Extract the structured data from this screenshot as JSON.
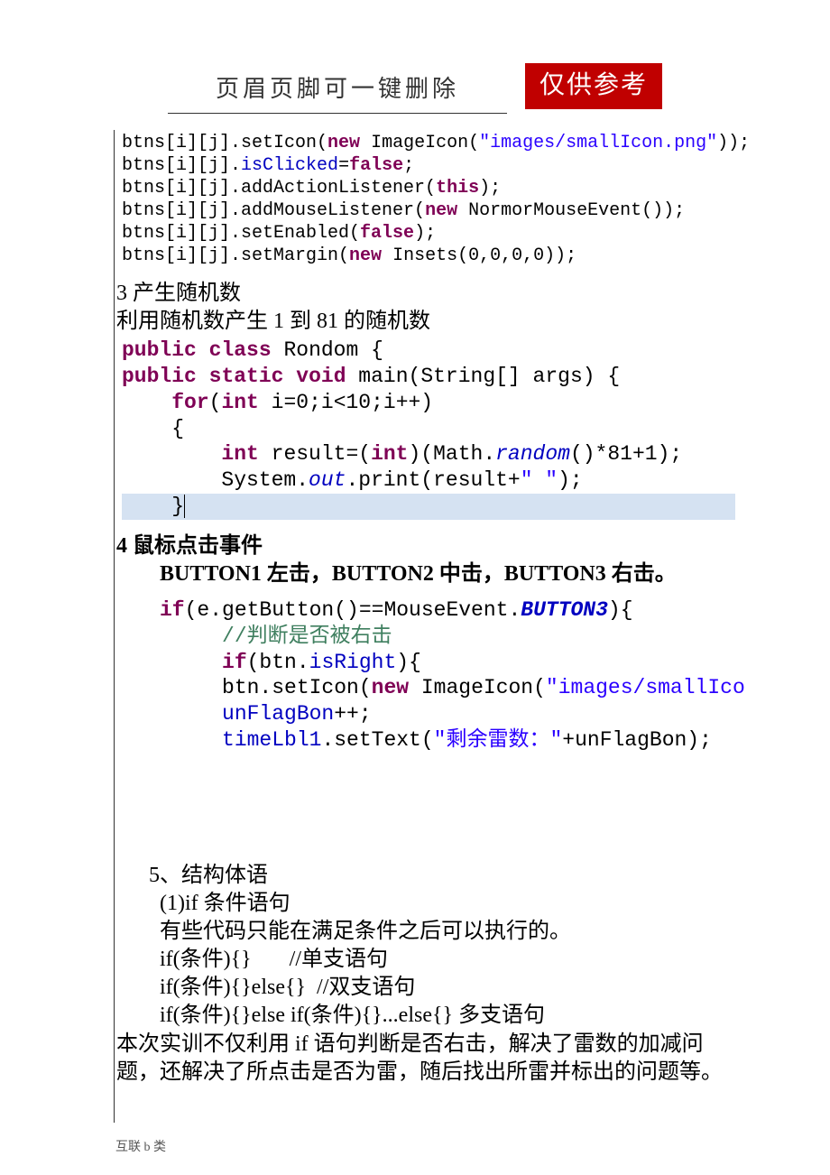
{
  "header": {
    "title": "页眉页脚可一键删除",
    "badge": "仅供参考"
  },
  "code1": {
    "l1_a": "btns[i][j].setIcon(",
    "l1_b": "new",
    "l1_c": " ImageIcon(",
    "l1_d": "\"images/smallIcon.png\"",
    "l1_e": "));",
    "l2_a": "btns[i][j].",
    "l2_b": "isClicked",
    "l2_c": "=",
    "l2_d": "false",
    "l2_e": ";",
    "l3": "btns[i][j].addActionListener(",
    "l3_b": "this",
    "l3_c": ");",
    "l4_a": "btns[i][j].addMouseListener(",
    "l4_b": "new",
    "l4_c": " NormorMouseEvent());",
    "l5_a": "btns[i][j].setEnabled(",
    "l5_b": "false",
    "l5_c": ");",
    "l6_a": "btns[i][j].setMargin(",
    "l6_b": "new",
    "l6_c": " Insets(0,0,0,0));"
  },
  "sec3": {
    "title": "3 产生随机数",
    "desc": "利用随机数产生 1 到 81 的随机数"
  },
  "code2": {
    "l1_a": "public",
    "l1_b": " ",
    "l1_c": "class",
    "l1_d": " Rondom {",
    "l2_a": "public",
    "l2_b": " ",
    "l2_c": "static",
    "l2_d": " ",
    "l2_e": "void",
    "l2_f": " main(String[] args) {",
    "l3_a": "for",
    "l3_b": "(",
    "l3_c": "int",
    "l3_d": " i=0;i<10;i++)",
    "l4": "{",
    "l5_a": "int",
    "l5_b": " result=(",
    "l5_c": "int",
    "l5_d": ")(Math.",
    "l5_e": "random",
    "l5_f": "()*81+1);",
    "l6_a": "System.",
    "l6_b": "out",
    "l6_c": ".print(result+",
    "l6_d": "\" \"",
    "l6_e": ");",
    "l7": "}"
  },
  "sec4": {
    "title": "4 鼠标点击事件",
    "desc": "BUTTON1 左击，BUTTON2 中击，BUTTON3 右击。"
  },
  "code3": {
    "l1_a": "if",
    "l1_b": "(e.getButton()==MouseEvent.",
    "l1_c": "BUTTON3",
    "l1_d": "){",
    "l2": "//判断是否被右击",
    "l3_a": "if",
    "l3_b": "(btn.",
    "l3_c": "isRight",
    "l3_d": "){",
    "l4_a": "btn.setIcon(",
    "l4_b": "new",
    "l4_c": " ImageIcon(",
    "l4_d": "\"images/smallIco",
    "l5_a": "unFlagBon",
    "l5_b": "++;",
    "l6_a": "timeLbl1",
    "l6_b": ".setText(",
    "l6_c": "\"剩余雷数：\"",
    "l6_d": "+unFlagBon);"
  },
  "sec5": {
    "title": "5、结构体语",
    "l1": "(1)if 条件语句",
    "l2": "有些代码只能在满足条件之后可以执行的。",
    "l3": "if(条件){}       //单支语句",
    "l4": "if(条件){}else{}  //双支语句",
    "l5": "if(条件){}else if(条件){}...else{} 多支语句",
    "p1": "本次实训不仅利用 if 语句判断是否右击，解决了雷数的加减问题，还解决了所点击是否为雷，随后找出所雷并标出的问题等。"
  },
  "footer": "互联 b 类"
}
